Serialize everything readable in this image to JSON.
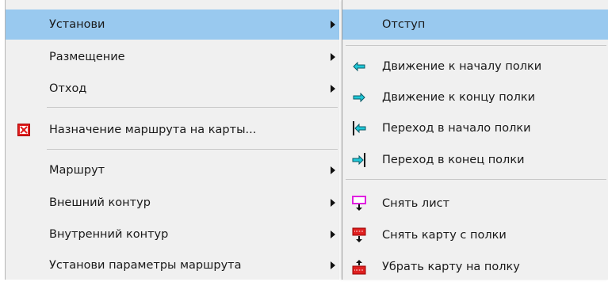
{
  "main_menu": {
    "items": [
      {
        "label": "Установи",
        "has_submenu": true,
        "highlighted": true
      },
      {
        "label": "Размещение",
        "has_submenu": true
      },
      {
        "label": "Отход",
        "has_submenu": true
      },
      {
        "label": "Назначение маршрута на карты...",
        "icon": "route-assign-icon"
      },
      {
        "label": "Маршрут",
        "has_submenu": true
      },
      {
        "label": "Внешний контур",
        "has_submenu": true
      },
      {
        "label": "Внутренний контур",
        "has_submenu": true
      },
      {
        "label": "Установи параметры маршрута",
        "has_submenu": true
      }
    ]
  },
  "sub_menu": {
    "items": [
      {
        "label": "Отступ",
        "highlighted": true
      },
      {
        "label": "Движение к началу полки",
        "icon": "arrow-left-icon"
      },
      {
        "label": "Движение к концу полки",
        "icon": "arrow-right-icon"
      },
      {
        "label": "Переход в начало полки",
        "icon": "jump-to-start-icon"
      },
      {
        "label": "Переход в конец полки",
        "icon": "jump-to-end-icon"
      },
      {
        "label": "Снять лист",
        "icon": "remove-sheet-icon"
      },
      {
        "label": "Снять карту с полки",
        "icon": "remove-card-icon"
      },
      {
        "label": "Убрать карту на полку",
        "icon": "store-card-icon"
      }
    ]
  },
  "colors": {
    "highlight": "#99c9ef",
    "menu_bg": "#f0f0f0",
    "arrow_icon": "#1fc8d8",
    "magenta_icon": "#e020e0",
    "red_icon": "#e02020"
  }
}
